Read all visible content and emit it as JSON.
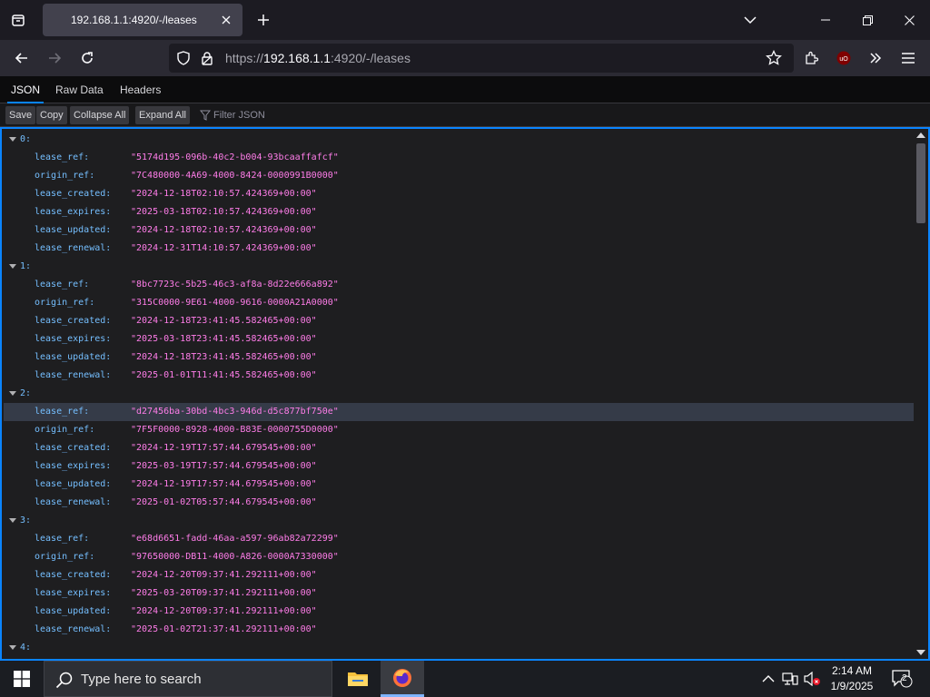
{
  "browser": {
    "tab_title": "192.168.1.1:4920/-/leases",
    "url_prefix": "https://",
    "url_host": "192.168.1.1",
    "url_rest": ":4920/-/leases"
  },
  "viewer": {
    "tabs": [
      "JSON",
      "Raw Data",
      "Headers"
    ],
    "toolbar": {
      "save": "Save",
      "copy": "Copy",
      "collapse_all": "Collapse All",
      "expand_all": "Expand All",
      "filter_placeholder": "Filter JSON"
    }
  },
  "rows": [
    {
      "type": "index",
      "label": "0:"
    },
    {
      "type": "kv",
      "key": "lease_ref:",
      "value": "\"5174d195-096b-40c2-b004-93bcaaffafcf\""
    },
    {
      "type": "kv",
      "key": "origin_ref:",
      "value": "\"7C480000-4A69-4000-8424-0000991B0000\""
    },
    {
      "type": "kv",
      "key": "lease_created:",
      "value": "\"2024-12-18T02:10:57.424369+00:00\""
    },
    {
      "type": "kv",
      "key": "lease_expires:",
      "value": "\"2025-03-18T02:10:57.424369+00:00\""
    },
    {
      "type": "kv",
      "key": "lease_updated:",
      "value": "\"2024-12-18T02:10:57.424369+00:00\""
    },
    {
      "type": "kv",
      "key": "lease_renewal:",
      "value": "\"2024-12-31T14:10:57.424369+00:00\""
    },
    {
      "type": "index",
      "label": "1:"
    },
    {
      "type": "kv",
      "key": "lease_ref:",
      "value": "\"8bc7723c-5b25-46c3-af8a-8d22e666a892\""
    },
    {
      "type": "kv",
      "key": "origin_ref:",
      "value": "\"315C0000-9E61-4000-9616-0000A21A0000\""
    },
    {
      "type": "kv",
      "key": "lease_created:",
      "value": "\"2024-12-18T23:41:45.582465+00:00\""
    },
    {
      "type": "kv",
      "key": "lease_expires:",
      "value": "\"2025-03-18T23:41:45.582465+00:00\""
    },
    {
      "type": "kv",
      "key": "lease_updated:",
      "value": "\"2024-12-18T23:41:45.582465+00:00\""
    },
    {
      "type": "kv",
      "key": "lease_renewal:",
      "value": "\"2025-01-01T11:41:45.582465+00:00\""
    },
    {
      "type": "index",
      "label": "2:"
    },
    {
      "type": "kv",
      "key": "lease_ref:",
      "value": "\"d27456ba-30bd-4bc3-946d-d5c877bf750e\"",
      "highlighted": true
    },
    {
      "type": "kv",
      "key": "origin_ref:",
      "value": "\"7F5F0000-8928-4000-B83E-0000755D0000\""
    },
    {
      "type": "kv",
      "key": "lease_created:",
      "value": "\"2024-12-19T17:57:44.679545+00:00\""
    },
    {
      "type": "kv",
      "key": "lease_expires:",
      "value": "\"2025-03-19T17:57:44.679545+00:00\""
    },
    {
      "type": "kv",
      "key": "lease_updated:",
      "value": "\"2024-12-19T17:57:44.679545+00:00\""
    },
    {
      "type": "kv",
      "key": "lease_renewal:",
      "value": "\"2025-01-02T05:57:44.679545+00:00\""
    },
    {
      "type": "index",
      "label": "3:"
    },
    {
      "type": "kv",
      "key": "lease_ref:",
      "value": "\"e68d6651-fadd-46aa-a597-96ab82a72299\""
    },
    {
      "type": "kv",
      "key": "origin_ref:",
      "value": "\"97650000-DB11-4000-A826-0000A7330000\""
    },
    {
      "type": "kv",
      "key": "lease_created:",
      "value": "\"2024-12-20T09:37:41.292111+00:00\""
    },
    {
      "type": "kv",
      "key": "lease_expires:",
      "value": "\"2025-03-20T09:37:41.292111+00:00\""
    },
    {
      "type": "kv",
      "key": "lease_updated:",
      "value": "\"2024-12-20T09:37:41.292111+00:00\""
    },
    {
      "type": "kv",
      "key": "lease_renewal:",
      "value": "\"2025-01-02T21:37:41.292111+00:00\""
    },
    {
      "type": "index",
      "label": "4:"
    }
  ],
  "taskbar": {
    "search_placeholder": "Type here to search",
    "time": "2:14 AM",
    "date": "1/9/2025",
    "notification_count": "2"
  },
  "colors": {
    "accent": "#0a84ff",
    "json_key": "#75bfff",
    "json_string": "#ff7de9"
  }
}
